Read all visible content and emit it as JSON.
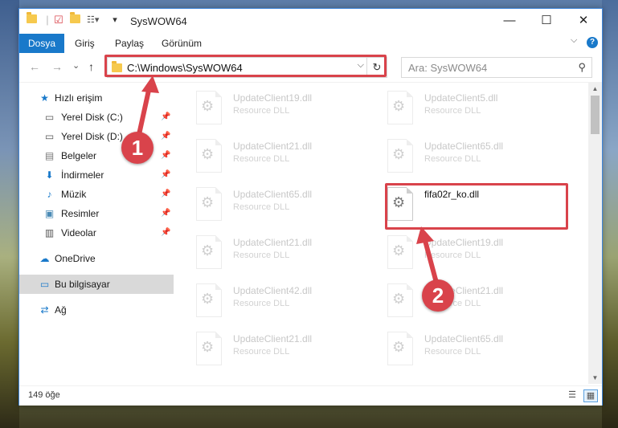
{
  "colors": {
    "accent": "#1979ca",
    "highlight": "#d9434b",
    "folder": "#f6c94e"
  },
  "window": {
    "title": "SysWOW64",
    "minimize": "—",
    "maximize": "☐",
    "close": "✕"
  },
  "ribbon": {
    "tabs": [
      "Dosya",
      "Giriş",
      "Paylaş",
      "Görünüm"
    ],
    "expand": "⌵",
    "help": "?"
  },
  "nav": {
    "back": "←",
    "forward": "→",
    "recent": "⌄",
    "up": "↑"
  },
  "address": {
    "path": "C:\\Windows\\SysWOW64",
    "dropdown": "⌵",
    "refresh": "↻"
  },
  "search": {
    "placeholder": "Ara: SysWOW64",
    "icon": "⚲"
  },
  "sidebar": {
    "items": [
      {
        "label": "Hızlı erişim",
        "icon": "star-icon",
        "glyph": "★"
      },
      {
        "label": "Yerel Disk (C:)",
        "icon": "drive-icon",
        "glyph": "▭",
        "pin": "📌"
      },
      {
        "label": "Yerel Disk (D:)",
        "icon": "drive-icon",
        "glyph": "▭",
        "pin": "📌"
      },
      {
        "label": "Belgeler",
        "icon": "documents-icon",
        "glyph": "▤",
        "pin": "📌"
      },
      {
        "label": "İndirmeler",
        "icon": "download-icon",
        "glyph": "⬇",
        "pin": "📌"
      },
      {
        "label": "Müzik",
        "icon": "music-icon",
        "glyph": "♪",
        "pin": "📌"
      },
      {
        "label": "Resimler",
        "icon": "pictures-icon",
        "glyph": "▣",
        "pin": "📌"
      },
      {
        "label": "Videolar",
        "icon": "video-icon",
        "glyph": "▥",
        "pin": "📌"
      },
      {
        "label": "OneDrive",
        "icon": "cloud-icon",
        "glyph": "☁"
      },
      {
        "label": "Bu bilgisayar",
        "icon": "computer-icon",
        "glyph": "▭"
      },
      {
        "label": "Ağ",
        "icon": "network-icon",
        "glyph": "⇄"
      }
    ]
  },
  "files": [
    {
      "name": "UpdateClient19.dll",
      "type": "Resource DLL"
    },
    {
      "name": "UpdateClient5.dll",
      "type": "Resource DLL"
    },
    {
      "name": "UpdateClient21.dll",
      "type": "Resource DLL"
    },
    {
      "name": "UpdateClient65.dll",
      "type": "Resource DLL"
    },
    {
      "name": "UpdateClient65.dll",
      "type": "Resource DLL"
    },
    {
      "name": "fifa02r_ko.dll",
      "type": ""
    },
    {
      "name": "UpdateClient21.dll",
      "type": "Resource DLL"
    },
    {
      "name": "UpdateClient19.dll",
      "type": "Resource DLL"
    },
    {
      "name": "UpdateClient42.dll",
      "type": "Resource DLL"
    },
    {
      "name": "UpdateClient21.dll",
      "type": "Resource DLL"
    },
    {
      "name": "UpdateClient21.dll",
      "type": "Resource DLL"
    },
    {
      "name": "UpdateClient65.dll",
      "type": "Resource DLL"
    }
  ],
  "status": {
    "count": "149 öğe"
  },
  "markers": {
    "one": "1",
    "two": "2"
  }
}
